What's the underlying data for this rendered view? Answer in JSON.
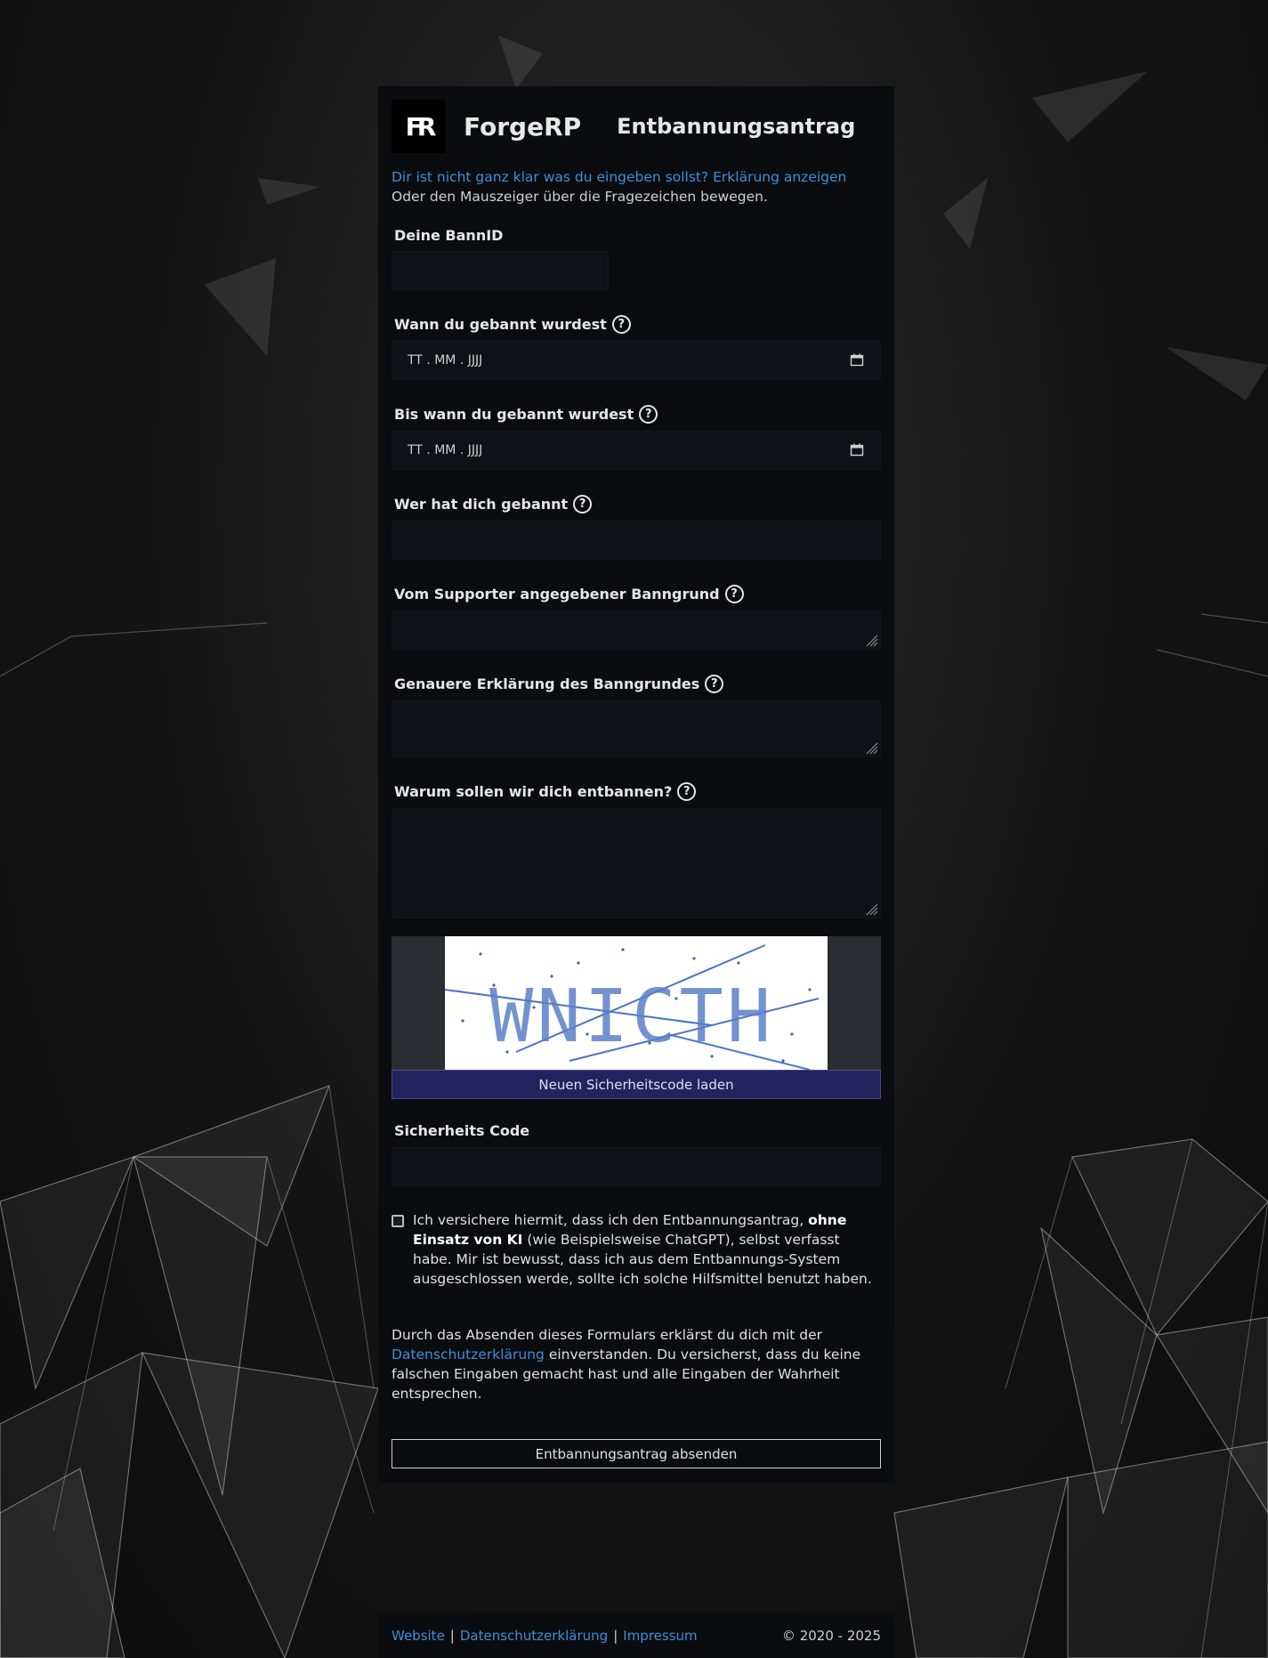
{
  "header": {
    "logo_text": "FR",
    "brand": "ForgeRP",
    "title": "Entbannungsantrag"
  },
  "help": {
    "link_text": "Dir ist nicht ganz klar was du eingeben sollst? Erklärung anzeigen",
    "hint_text": "Oder den Mauszeiger über die Fragezeichen bewegen."
  },
  "fields": {
    "bann_id": {
      "label": "Deine BannID",
      "value": ""
    },
    "banned_date": {
      "label": "Wann du gebannt wurdest",
      "placeholder": "TT . MM . JJJJ"
    },
    "until_date": {
      "label": "Bis wann du gebannt wurdest",
      "placeholder": "TT . MM . JJJJ"
    },
    "banned_by": {
      "label": "Wer hat dich gebannt",
      "value": ""
    },
    "supporter_reason": {
      "label": "Vom Supporter angegebener Banngrund",
      "value": ""
    },
    "detailed_reason": {
      "label": "Genauere Erklärung des Banngrundes",
      "value": ""
    },
    "why_unban": {
      "label": "Warum sollen wir dich entbannen?",
      "value": ""
    },
    "security_code": {
      "label": "Sicherheits Code",
      "value": ""
    }
  },
  "captcha": {
    "text": "WNICTH",
    "reload_label": "Neuen Sicherheitscode laden"
  },
  "ai_checkbox": {
    "checked": false,
    "text_before": "Ich versichere hiermit, dass ich den Entbannungsantrag, ",
    "text_bold": "ohne Einsatz von KI",
    "text_after": " (wie Beispielsweise ChatGPT), selbst verfasst habe. Mir ist bewusst, dass ich aus dem Entbannungs-System ausgeschlossen werde, sollte ich solche Hilfsmittel benutzt haben."
  },
  "consent": {
    "text_before": "Durch das Absenden dieses Formulars erklärst du dich mit der ",
    "link_text": "Datenschutzerklärung",
    "text_after": " einverstanden. Du versicherst, dass du keine falschen Eingaben gemacht hast und alle Eingaben der Wahrheit entsprechen."
  },
  "submit_label": "Entbannungsantrag absenden",
  "footer": {
    "links": [
      "Website",
      "Datenschutzerklärung",
      "Impressum"
    ],
    "separator": "|",
    "copyright": "© 2020 - 2025"
  },
  "icons": {
    "help": "question-circle-icon",
    "calendar": "calendar-icon",
    "resize": "resize-grip-icon"
  },
  "colors": {
    "link": "#3d8fdb",
    "panel_bg": "#0a0c0f",
    "input_bg": "#0e1217",
    "captcha_button_bg": "#23235e"
  }
}
